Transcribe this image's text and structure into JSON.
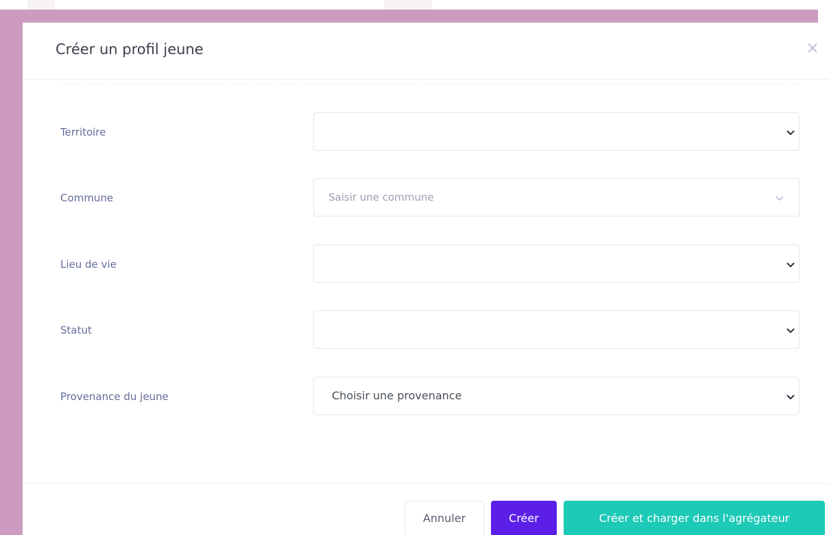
{
  "modal": {
    "title": "Créer un profil jeune",
    "close_icon": "close-icon"
  },
  "form": {
    "fields": [
      {
        "label": "Territoire",
        "value": "",
        "type": "select"
      },
      {
        "label": "Commune",
        "placeholder": "Saisir une commune",
        "type": "autocomplete"
      },
      {
        "label": "Lieu de vie",
        "value": "",
        "type": "select"
      },
      {
        "label": "Statut",
        "value": "",
        "type": "select"
      },
      {
        "label": "Provenance du jeune",
        "value": "Choisir une provenance",
        "type": "select"
      }
    ]
  },
  "footer": {
    "cancel_label": "Annuler",
    "create_label": "Créer",
    "create_load_label": "Créer et charger dans l'agrégateur"
  },
  "colors": {
    "backdrop": "#cd9bbf",
    "primary": "#5b1fe8",
    "accent": "#1dc9b7",
    "label": "#646c9a"
  }
}
